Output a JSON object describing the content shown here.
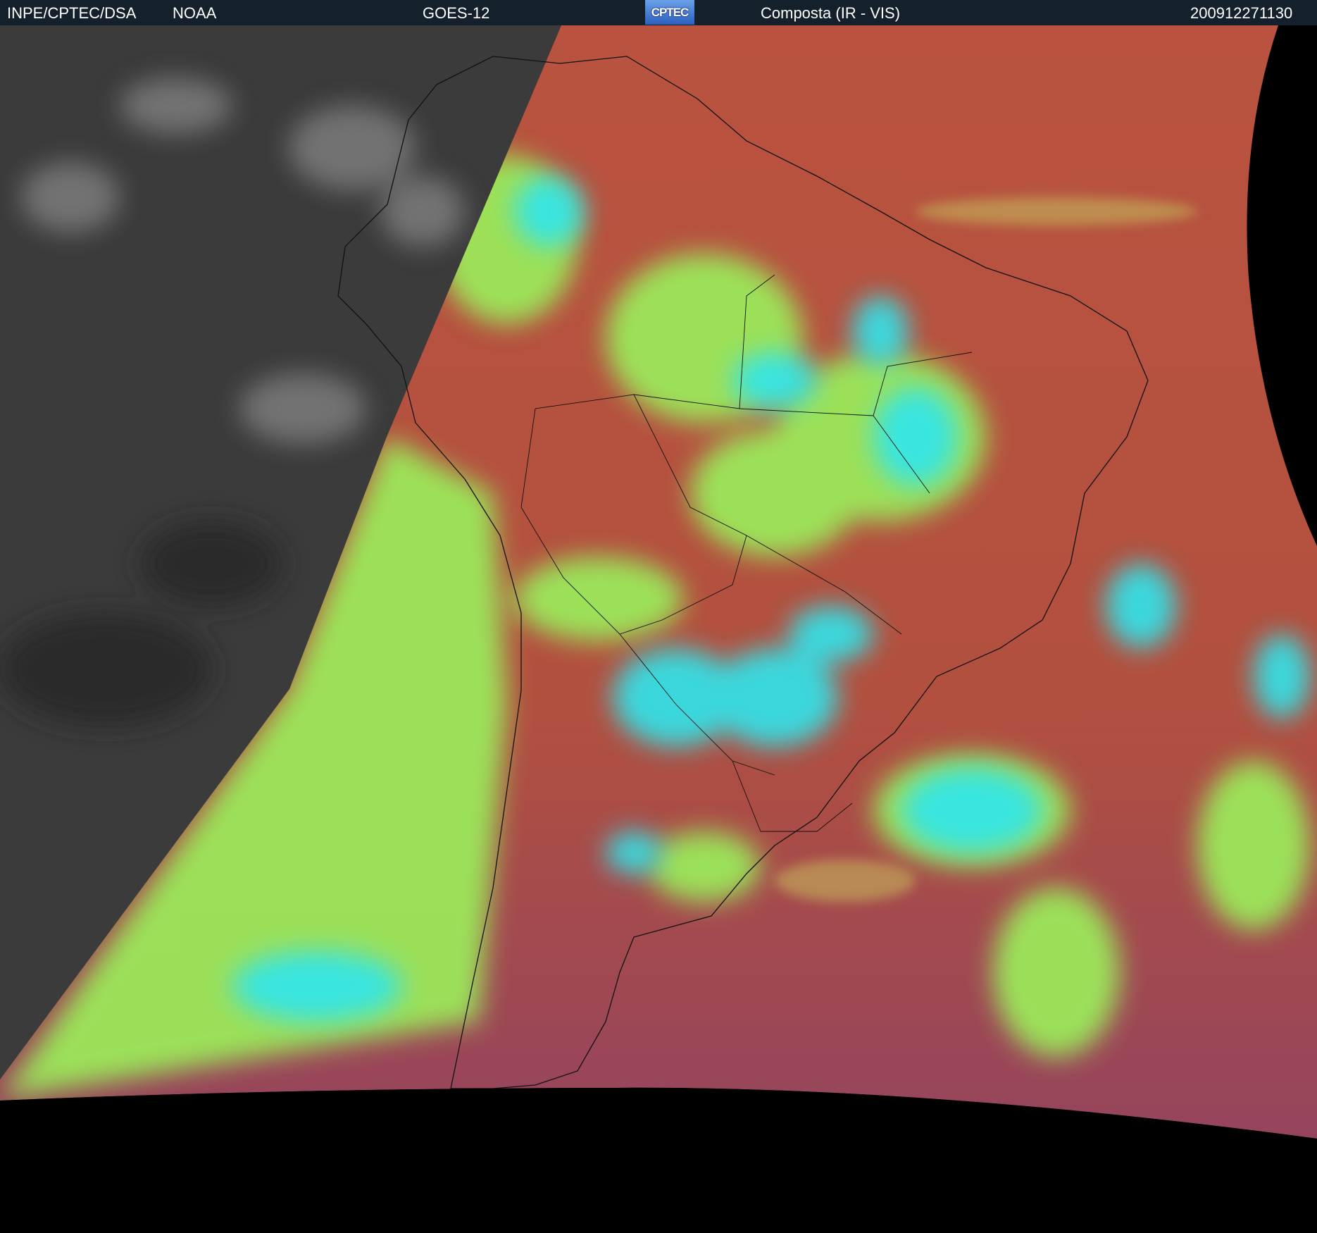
{
  "header": {
    "institution": "INPE/CPTEC/DSA",
    "agency": "NOAA",
    "satellite": "GOES-12",
    "logo_text": "CPTEC",
    "product": "Composta (IR - VIS)",
    "timestamp": "200912271130"
  },
  "colors": {
    "header_bg": "#14202b",
    "ocean_warm": "#b5503f",
    "cloud_low": "#9be85a",
    "cloud_high": "#28e6f0",
    "night_gray": "#3a3a3a",
    "space": "#000000"
  }
}
